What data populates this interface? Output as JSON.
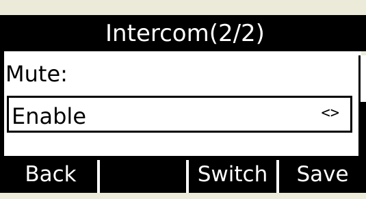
{
  "title": "Intercom(2/2)",
  "field": {
    "label": "Mute:",
    "value": "Enable",
    "switch_indicator": "<>"
  },
  "softkeys": [
    "Back",
    "",
    "Switch",
    "Save"
  ],
  "colors": {
    "background": "#ffffff",
    "bars": "#000000",
    "bar_text": "#ffffff",
    "outer": "#ecead8"
  }
}
